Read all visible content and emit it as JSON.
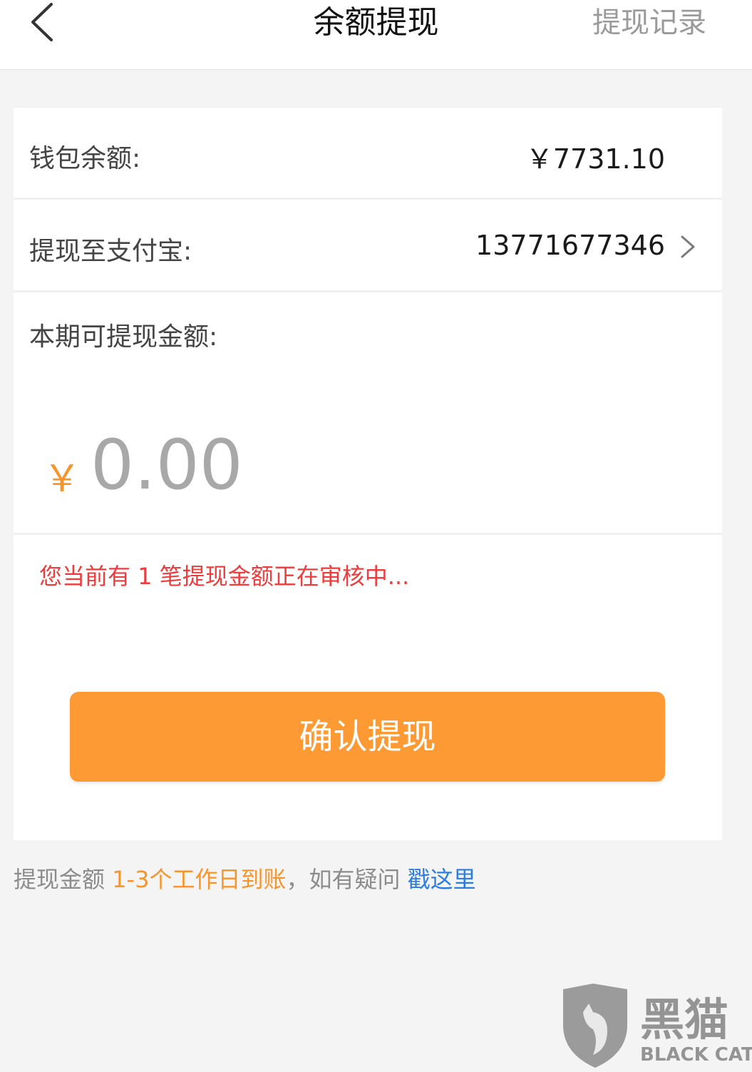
{
  "nav": {
    "title": "余额提现",
    "right_action": "提现记录"
  },
  "balance": {
    "label": "钱包余额:",
    "value": "￥7731.10"
  },
  "alipay": {
    "label": "提现至支付宝:",
    "account": "13771677346"
  },
  "withdraw": {
    "label": "本期可提现金额:",
    "currency_symbol": "￥",
    "amount_placeholder": "0.00"
  },
  "warning": "您当前有 1 笔提现金额正在审核中...",
  "confirm_label": "确认提现",
  "footer": {
    "prefix": "提现金额 ",
    "highlight": "1-3个工作日到账",
    "middle": "，如有疑问 ",
    "link": "戳这里"
  },
  "watermark": {
    "brand_cn": "黑猫",
    "brand_en": "BLACK CAT"
  },
  "colors": {
    "accent_orange": "#fd9a33",
    "warning_red": "#ee3b3b",
    "link_blue": "#2b7de0"
  },
  "icons": {
    "back": "chevron-left-icon",
    "row_arrow": "chevron-right-icon",
    "watermark": "shield-cat-icon"
  }
}
